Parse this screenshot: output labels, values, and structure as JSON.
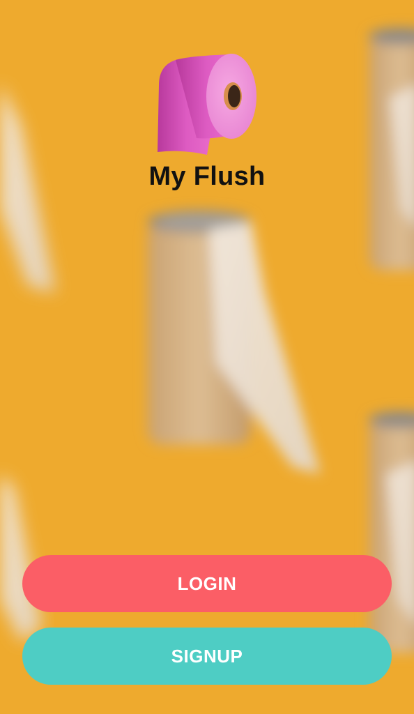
{
  "app": {
    "title": "My Flush"
  },
  "buttons": {
    "login_label": "LOGIN",
    "signup_label": "SIGNUP"
  },
  "colors": {
    "background": "#EEAA2E",
    "login_button": "#FB5E66",
    "signup_button": "#4ECDC4",
    "logo_pink": "#E867C8",
    "title_text": "#111111"
  },
  "icons": {
    "logo": "toilet-paper-roll-icon",
    "background": "blurred-toilet-paper-rolls"
  }
}
